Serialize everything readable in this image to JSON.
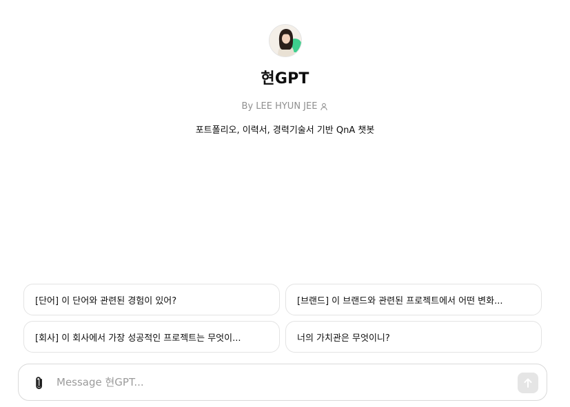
{
  "gpt": {
    "name": "현GPT",
    "author": "By LEE HYUN JEE",
    "description": "포트폴리오, 이력서, 경력기술서 기반 QnA 챗봇"
  },
  "starters": [
    "[단어] 이 단어와 관련된 경험이 있어?",
    "[브랜드] 이 브랜드와 관련된 프로젝트에서 어떤 변화...",
    "[회사] 이 회사에서 가장 성공적인 프로젝트는 무엇이...",
    "너의 가치관은 무엇이니?"
  ],
  "composer": {
    "placeholder": "Message 현GPT..."
  },
  "icons": {
    "author": "person-icon",
    "attach": "paperclip-icon",
    "send": "arrow-up-icon"
  },
  "colors": {
    "send_button_bg": "#e5e5e5",
    "muted_text": "#8f8f8f"
  }
}
